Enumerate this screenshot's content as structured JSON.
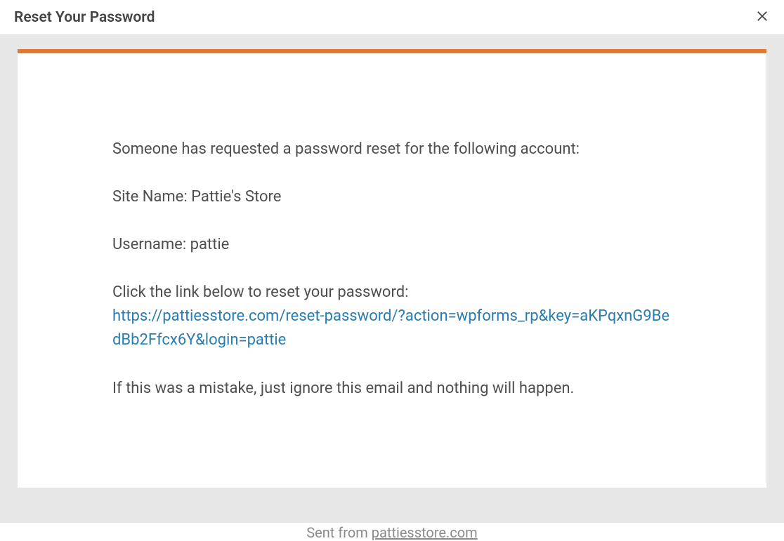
{
  "header": {
    "title": "Reset Your Password"
  },
  "email": {
    "intro": "Someone has requested a password reset for the following account:",
    "site_name_line": "Site Name: Pattie's Store",
    "username_line": "Username: pattie",
    "click_line": "Click the link below to reset your password:",
    "reset_link": "https://pattiesstore.com/reset-password/?action=wpforms_rp&key=aKPqxnG9BedBb2Ffcx6Y&login=pattie",
    "mistake_line": "If this was a mistake, just ignore this email and nothing will happen."
  },
  "footer": {
    "sent_from_prefix": "Sent from ",
    "domain": "pattiesstore.com"
  },
  "colors": {
    "accent": "#e27730",
    "link": "#2a7db0",
    "body_bg": "#e7e7e7",
    "text": "#4f4f4f",
    "muted": "#8b8b8b"
  }
}
